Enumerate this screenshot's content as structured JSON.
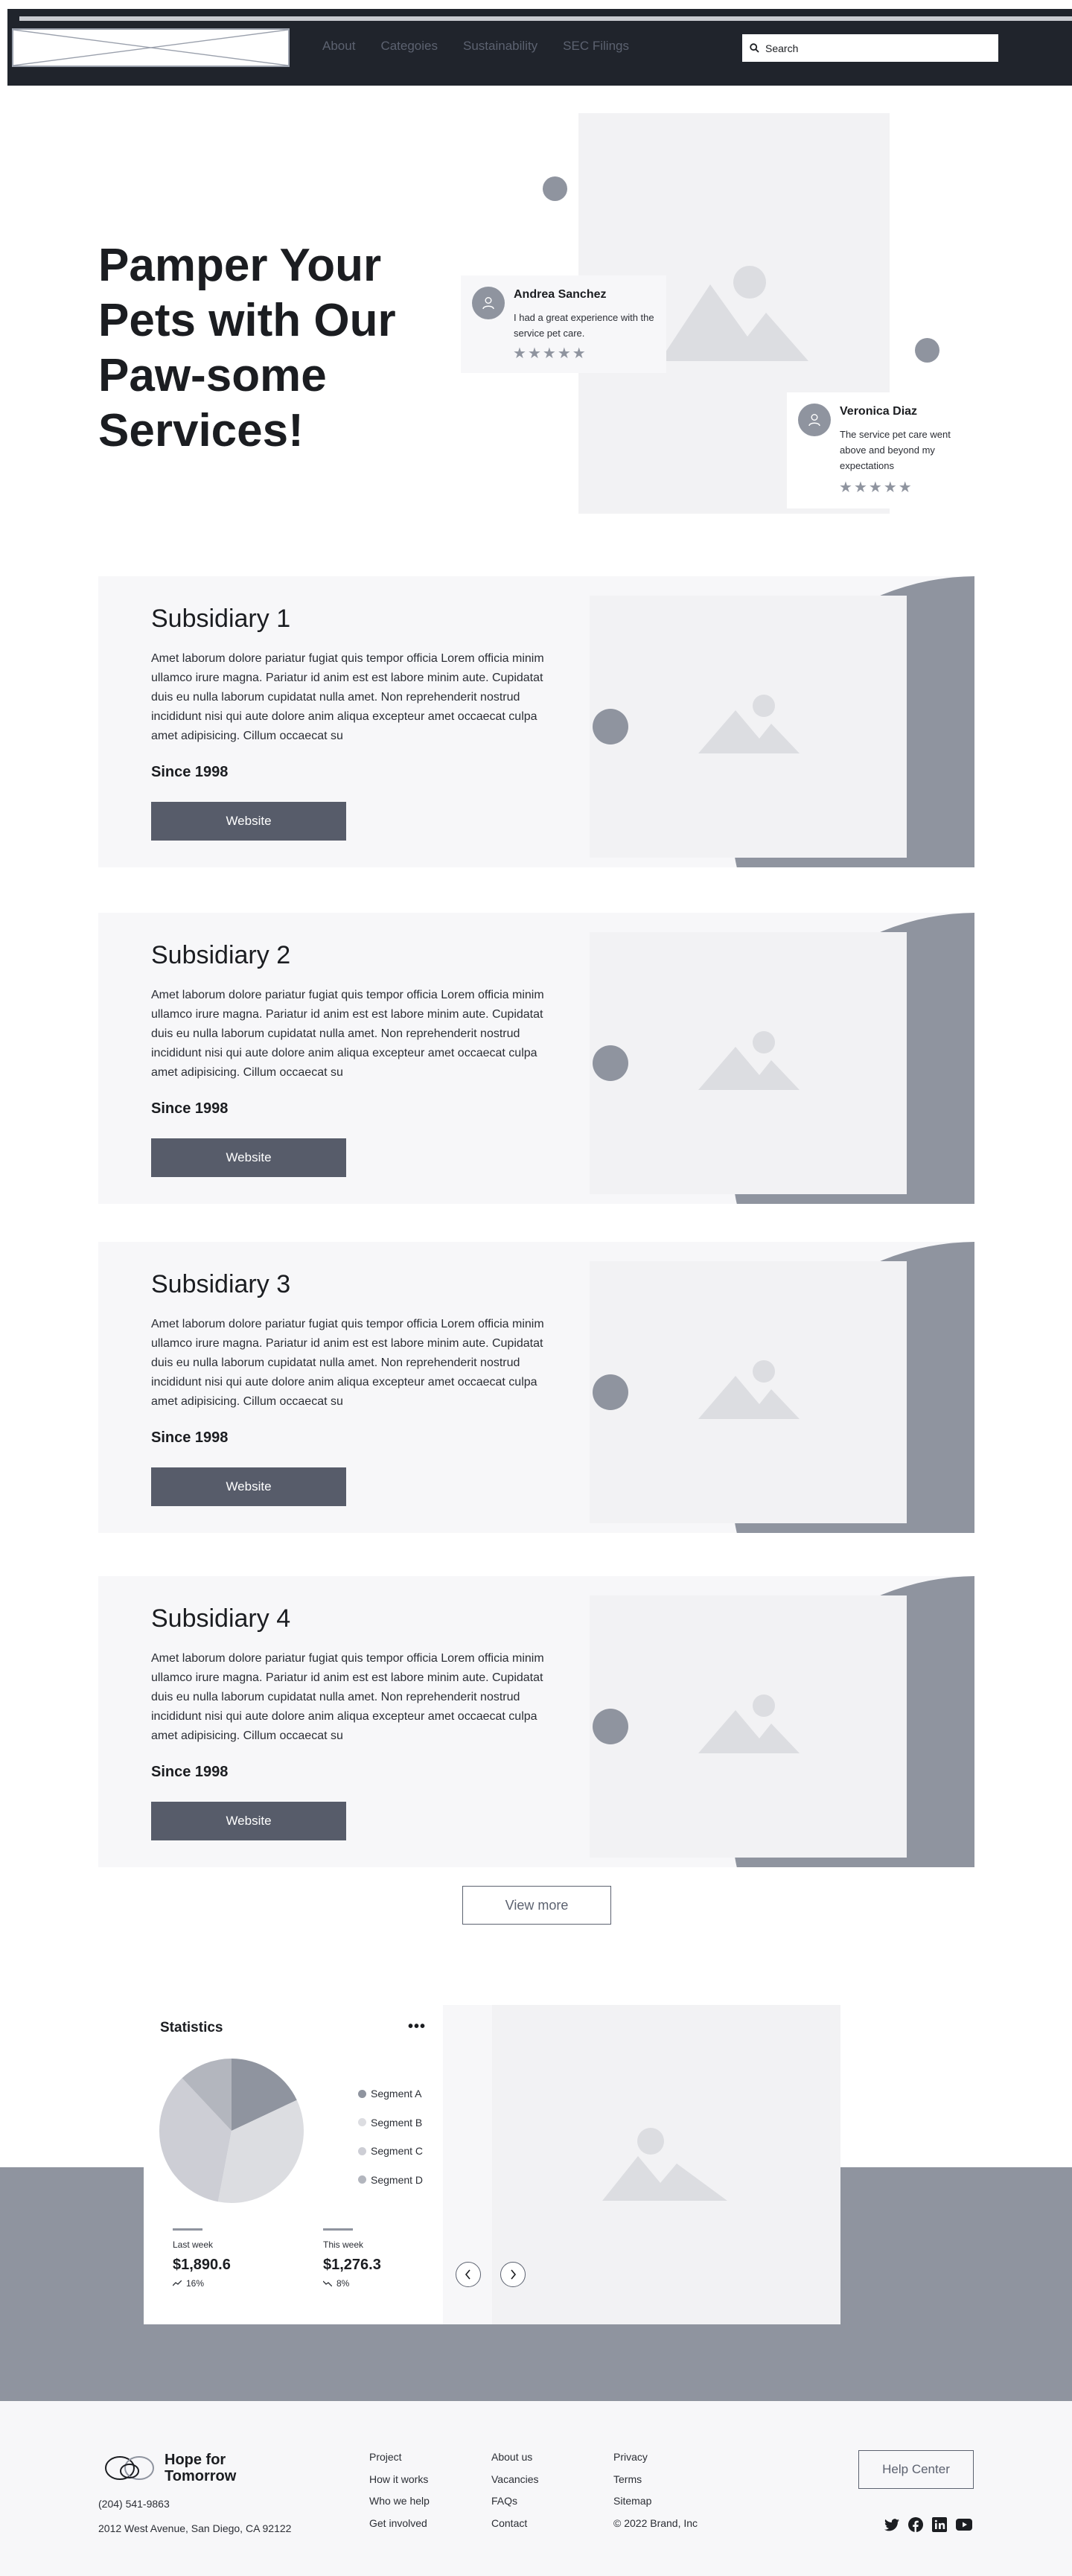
{
  "header": {
    "nav": [
      "About",
      "Categoies",
      "Sustainability",
      "SEC Filings"
    ],
    "search_placeholder": "Search"
  },
  "hero": {
    "title": "Pamper Your Pets with Our Paw-some Services!",
    "reviews": [
      {
        "name": "Andrea Sanchez",
        "text": "I had a great experience with the service pet care.",
        "stars": 5
      },
      {
        "name": "Veronica Diaz",
        "text": "The service pet care went above and beyond my expectations",
        "stars": 5
      }
    ]
  },
  "subsidiaries": [
    {
      "title": "Subsidiary 1",
      "body": "Amet laborum dolore pariatur fugiat quis tempor officia Lorem officia minim ullamco irure magna. Pariatur id anim est est labore minim aute. Cupidatat duis eu nulla laborum cupidatat nulla amet. Non reprehenderit nostrud incididunt nisi qui aute dolore anim aliqua excepteur amet occaecat culpa amet adipisicing. Cillum occaecat su",
      "since": "Since 1998",
      "button": "Website"
    },
    {
      "title": "Subsidiary 2",
      "body": "Amet laborum dolore pariatur fugiat quis tempor officia Lorem officia minim ullamco irure magna. Pariatur id anim est est labore minim aute. Cupidatat duis eu nulla laborum cupidatat nulla amet. Non reprehenderit nostrud incididunt nisi qui aute dolore anim aliqua excepteur amet occaecat culpa amet adipisicing. Cillum occaecat su",
      "since": "Since 1998",
      "button": "Website"
    },
    {
      "title": "Subsidiary 3",
      "body": "Amet laborum dolore pariatur fugiat quis tempor officia Lorem officia minim ullamco irure magna. Pariatur id anim est est labore minim aute. Cupidatat duis eu nulla laborum cupidatat nulla amet. Non reprehenderit nostrud incididunt nisi qui aute dolore anim aliqua excepteur amet occaecat culpa amet adipisicing. Cillum occaecat su",
      "since": "Since 1998",
      "button": "Website"
    },
    {
      "title": "Subsidiary 4",
      "body": "Amet laborum dolore pariatur fugiat quis tempor officia Lorem officia minim ullamco irure magna. Pariatur id anim est est labore minim aute. Cupidatat duis eu nulla laborum cupidatat nulla amet. Non reprehenderit nostrud incididunt nisi qui aute dolore anim aliqua excepteur amet occaecat culpa amet adipisicing. Cillum occaecat su",
      "since": "Since 1998",
      "button": "Website"
    }
  ],
  "view_more": "View more",
  "statistics": {
    "title": "Statistics",
    "more": "•••",
    "legend": [
      "Segment A",
      "Segment B",
      "Segment C",
      "Segment D"
    ],
    "metrics": [
      {
        "label": "Last week",
        "value": "$1,890.6",
        "change": "16%"
      },
      {
        "label": "This week",
        "value": "$1,276.3",
        "change": "8%"
      }
    ]
  },
  "chart_data": {
    "type": "pie",
    "title": "Statistics",
    "categories": [
      "Segment A",
      "Segment B",
      "Segment C",
      "Segment D"
    ],
    "values": [
      18,
      35,
      35,
      12
    ],
    "colors": [
      "#8f949f",
      "#dcdde1",
      "#cdced5",
      "#b3b6be"
    ]
  },
  "footer": {
    "brand": "Hope for Tomorrow",
    "phone": "(204) 541-9863",
    "address": "2012 West Avenue, San Diego, CA 92122",
    "columns": [
      [
        "Project",
        "How it works",
        "Who we help",
        "Get involved"
      ],
      [
        "About us",
        "Vacancies",
        "FAQs",
        "Contact"
      ],
      [
        "Privacy",
        "Terms",
        "Sitemap",
        "© 2022 Brand, Inc"
      ]
    ],
    "help_button": "Help Center",
    "socials": [
      "twitter-icon",
      "facebook-icon",
      "linkedin-icon",
      "youtube-icon"
    ]
  },
  "colors": {
    "header_bg": "#20242c",
    "accent_gray": "#8f949f",
    "button_bg": "#575c6a",
    "panel_bg": "#f7f7f9"
  }
}
